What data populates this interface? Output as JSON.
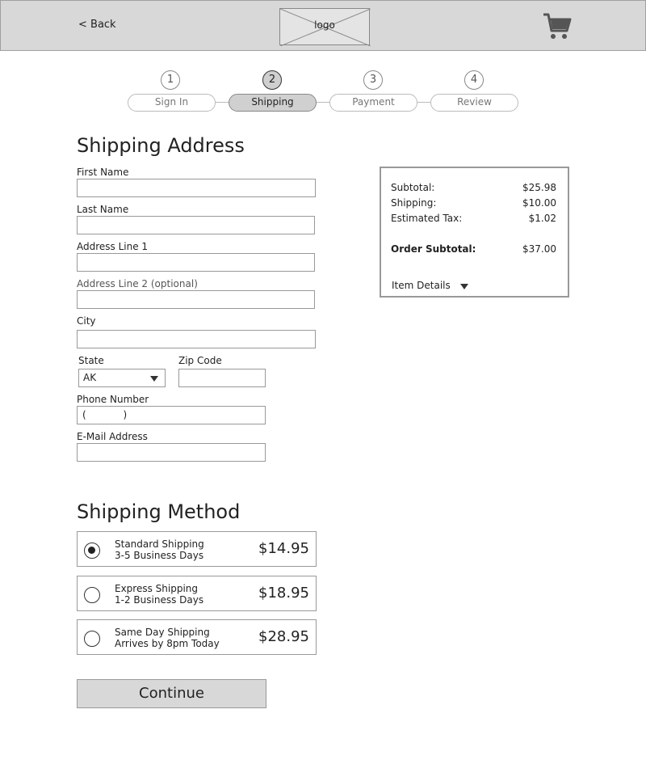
{
  "header": {
    "back_label": "< Back",
    "logo_text": "logo",
    "cart_icon": "shopping-cart-icon"
  },
  "steps": [
    {
      "number": "1",
      "label": "Sign In",
      "active": false
    },
    {
      "number": "2",
      "label": "Shipping",
      "active": true
    },
    {
      "number": "3",
      "label": "Payment",
      "active": false
    },
    {
      "number": "4",
      "label": "Review",
      "active": false
    }
  ],
  "address": {
    "title": "Shipping Address",
    "first_name_label": "First Name",
    "last_name_label": "Last Name",
    "address1_label": "Address Line 1",
    "address2_label": "Address Line 2 (optional)",
    "city_label": "City",
    "state_label": "State",
    "state_value": "AK",
    "zip_label": "Zip Code",
    "phone_label": "Phone Number",
    "phone_value": "(            )",
    "email_label": "E-Mail Address"
  },
  "summary": {
    "subtotal_label": "Subtotal:",
    "subtotal_value": "$25.98",
    "shipping_label": "Shipping:",
    "shipping_value": "$10.00",
    "tax_label": "Estimated Tax:",
    "tax_value": "$1.02",
    "order_subtotal_label": "Order Subtotal:",
    "order_subtotal_value": "$37.00",
    "item_details_label": "Item Details"
  },
  "method": {
    "title": "Shipping Method",
    "options": [
      {
        "name": "Standard Shipping",
        "days": "3-5 Business Days",
        "price": "$14.95",
        "selected": true
      },
      {
        "name": "Express Shipping",
        "days": "1-2 Business Days",
        "price": "$18.95",
        "selected": false
      },
      {
        "name": "Same Day Shipping",
        "days": "Arrives by 8pm Today",
        "price": "$28.95",
        "selected": false
      }
    ]
  },
  "continue_label": "Continue"
}
